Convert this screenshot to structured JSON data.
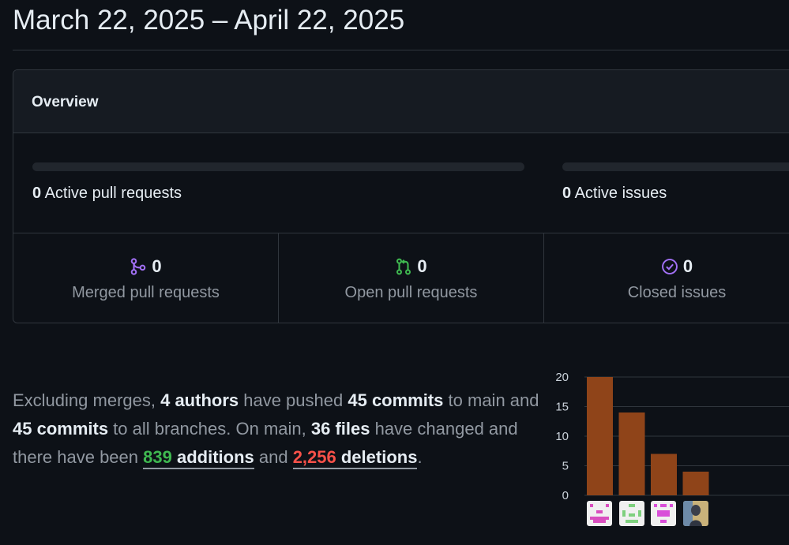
{
  "page": {
    "date_range": "March 22, 2025 – April 22, 2025"
  },
  "overview": {
    "title": "Overview",
    "active_prs": {
      "count": "0",
      "label": "Active pull requests",
      "fill": 0
    },
    "active_issues": {
      "count": "0",
      "label": "Active issues",
      "fill": 0
    },
    "stats": [
      {
        "icon": "merged-pr-icon",
        "count": "0",
        "label": "Merged pull requests",
        "color": "#a371f7"
      },
      {
        "icon": "open-pr-icon",
        "count": "0",
        "label": "Open pull requests",
        "color": "#3fb950"
      },
      {
        "icon": "closed-issue-icon",
        "count": "0",
        "label": "Closed issues",
        "color": "#a371f7"
      }
    ]
  },
  "summary": {
    "t1": "Excluding merges, ",
    "authors": "4 authors",
    "t2": " have pushed ",
    "commits_main": "45 commits",
    "t3": " to main and ",
    "commits_all": "45 commits",
    "t4": " to all branches. On main, ",
    "files": "36 files",
    "t5": " have changed and there have been ",
    "additions_num": "839",
    "additions_word": " additions",
    "t6": " and ",
    "deletions_num": "2,256",
    "deletions_word": " deletions",
    "t7": "."
  },
  "colors": {
    "bar": "#8f4419",
    "additions": "#3fb950",
    "deletions": "#f85149"
  },
  "chart_data": {
    "type": "bar",
    "categories": [
      "author-1",
      "author-2",
      "author-3",
      "author-4"
    ],
    "values": [
      20,
      14,
      7,
      4
    ],
    "ylim": [
      0,
      20
    ],
    "yticks": [
      "0",
      "5",
      "10",
      "15",
      "20"
    ],
    "grid": true,
    "x_tick_labels": "avatars"
  }
}
